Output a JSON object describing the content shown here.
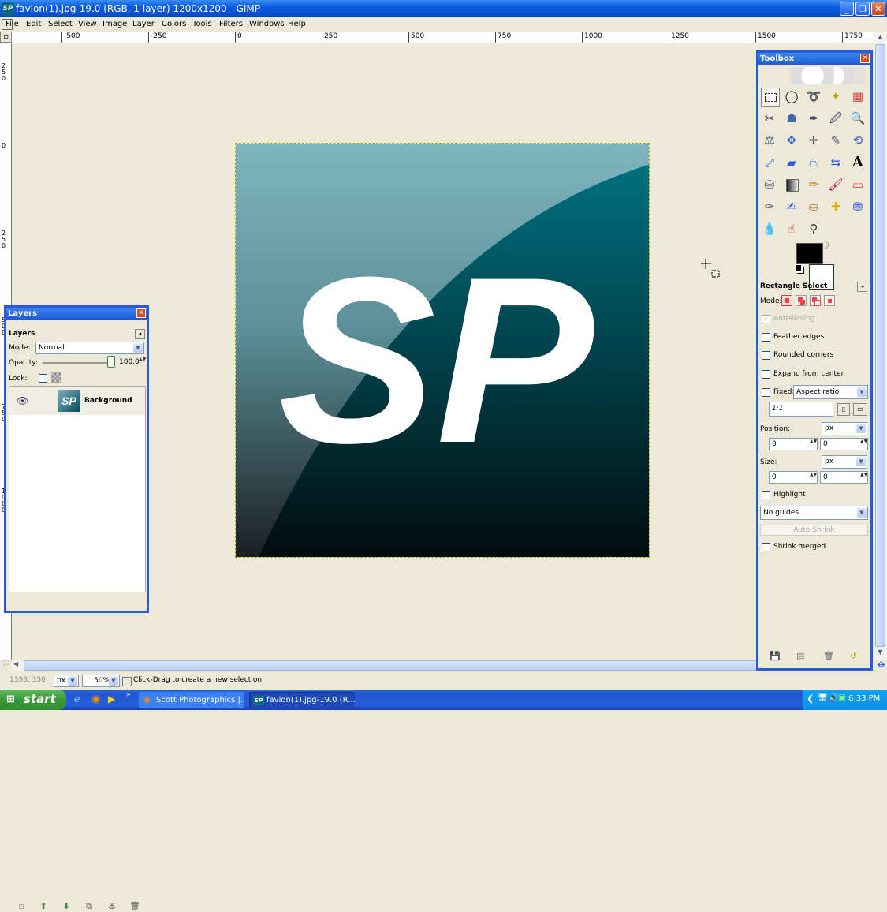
{
  "window": {
    "title": "favion(1).jpg-19.0 (RGB, 1 layer) 1200x1200 - GIMP"
  },
  "menu": [
    "File",
    "Edit",
    "Select",
    "View",
    "Image",
    "Layer",
    "Colors",
    "Tools",
    "Filters",
    "Windows",
    "Help"
  ],
  "ruler": {
    "h_labels": [
      "-500",
      "-250",
      "0",
      "250",
      "500",
      "750",
      "1000",
      "1250",
      "1500",
      "1750"
    ],
    "v_labels": [
      "250",
      "0",
      "250",
      "500",
      "750",
      "1000"
    ]
  },
  "image_text": "SP",
  "layers": {
    "title": "Layers",
    "tab_label": "Layers",
    "mode_label": "Mode:",
    "mode_value": "Normal",
    "opacity_label": "Opacity:",
    "opacity_value": "100.0",
    "lock_label": "Lock:",
    "layer_name": "Background",
    "thumb_text": "SP"
  },
  "toolbox": {
    "title": "Toolbox",
    "tool_options_title": "Rectangle Select",
    "mode_label": "Mode:",
    "antialiasing": "Antialiasing",
    "feather": "Feather edges",
    "rounded": "Rounded corners",
    "expand": "Expand from center",
    "fixed_label": "Fixed:",
    "fixed_value": "Aspect ratio",
    "ratio_value": "1:1",
    "position_label": "Position:",
    "position_unit": "px",
    "position_x": "0",
    "position_y": "0",
    "size_label": "Size:",
    "size_unit": "px",
    "size_w": "0",
    "size_h": "0",
    "highlight": "Highlight",
    "guides_value": "No guides",
    "auto_shrink": "Auto Shrink",
    "shrink_merged": "Shrink merged",
    "text_tool_glyph": "A"
  },
  "status": {
    "coords": "1358, 350",
    "unit": "px",
    "zoom": "50%",
    "message": "Click-Drag to create a new selection"
  },
  "taskbar": {
    "start": "start",
    "tasks": [
      "Scott Photographics |...",
      "favion(1).jpg-19.0 (R..."
    ],
    "clock": "6:33 PM"
  }
}
